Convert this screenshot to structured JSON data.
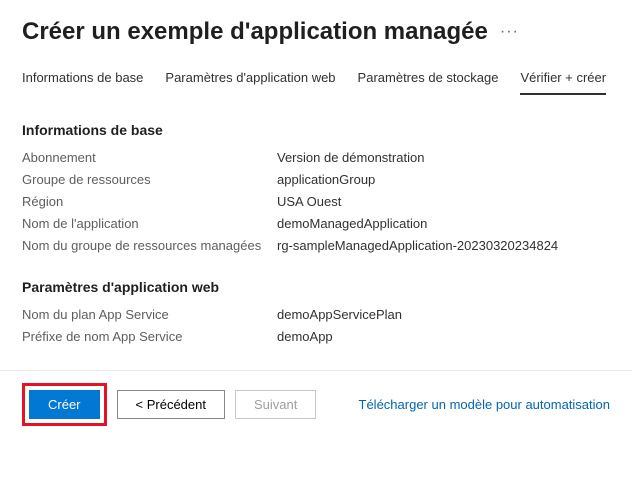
{
  "header": {
    "title": "Créer un exemple d'application managée",
    "more": "···"
  },
  "tabs": [
    {
      "label": "Informations de base"
    },
    {
      "label": "Paramètres d'application web"
    },
    {
      "label": "Paramètres de stockage"
    },
    {
      "label": "Vérifier + créer"
    }
  ],
  "sections": {
    "basics": {
      "title": "Informations de base",
      "rows": [
        {
          "key": "Abonnement",
          "val": "Version de démonstration"
        },
        {
          "key": "Groupe de ressources",
          "val": "applicationGroup"
        },
        {
          "key": "Région",
          "val": "USA Ouest"
        },
        {
          "key": "Nom de l'application",
          "val": "demoManagedApplication"
        },
        {
          "key": "Nom du groupe de ressources managées",
          "val": "rg-sampleManagedApplication-20230320234824"
        }
      ]
    },
    "web": {
      "title": "Paramètres d'application web",
      "rows": [
        {
          "key": "Nom du plan App Service",
          "val": "demoAppServicePlan"
        },
        {
          "key": "Préfixe de nom App Service",
          "val": "demoApp"
        }
      ]
    }
  },
  "footer": {
    "create": "Créer",
    "previous": "< Précédent",
    "next": "Suivant",
    "download": "Télécharger un modèle pour automatisation"
  }
}
